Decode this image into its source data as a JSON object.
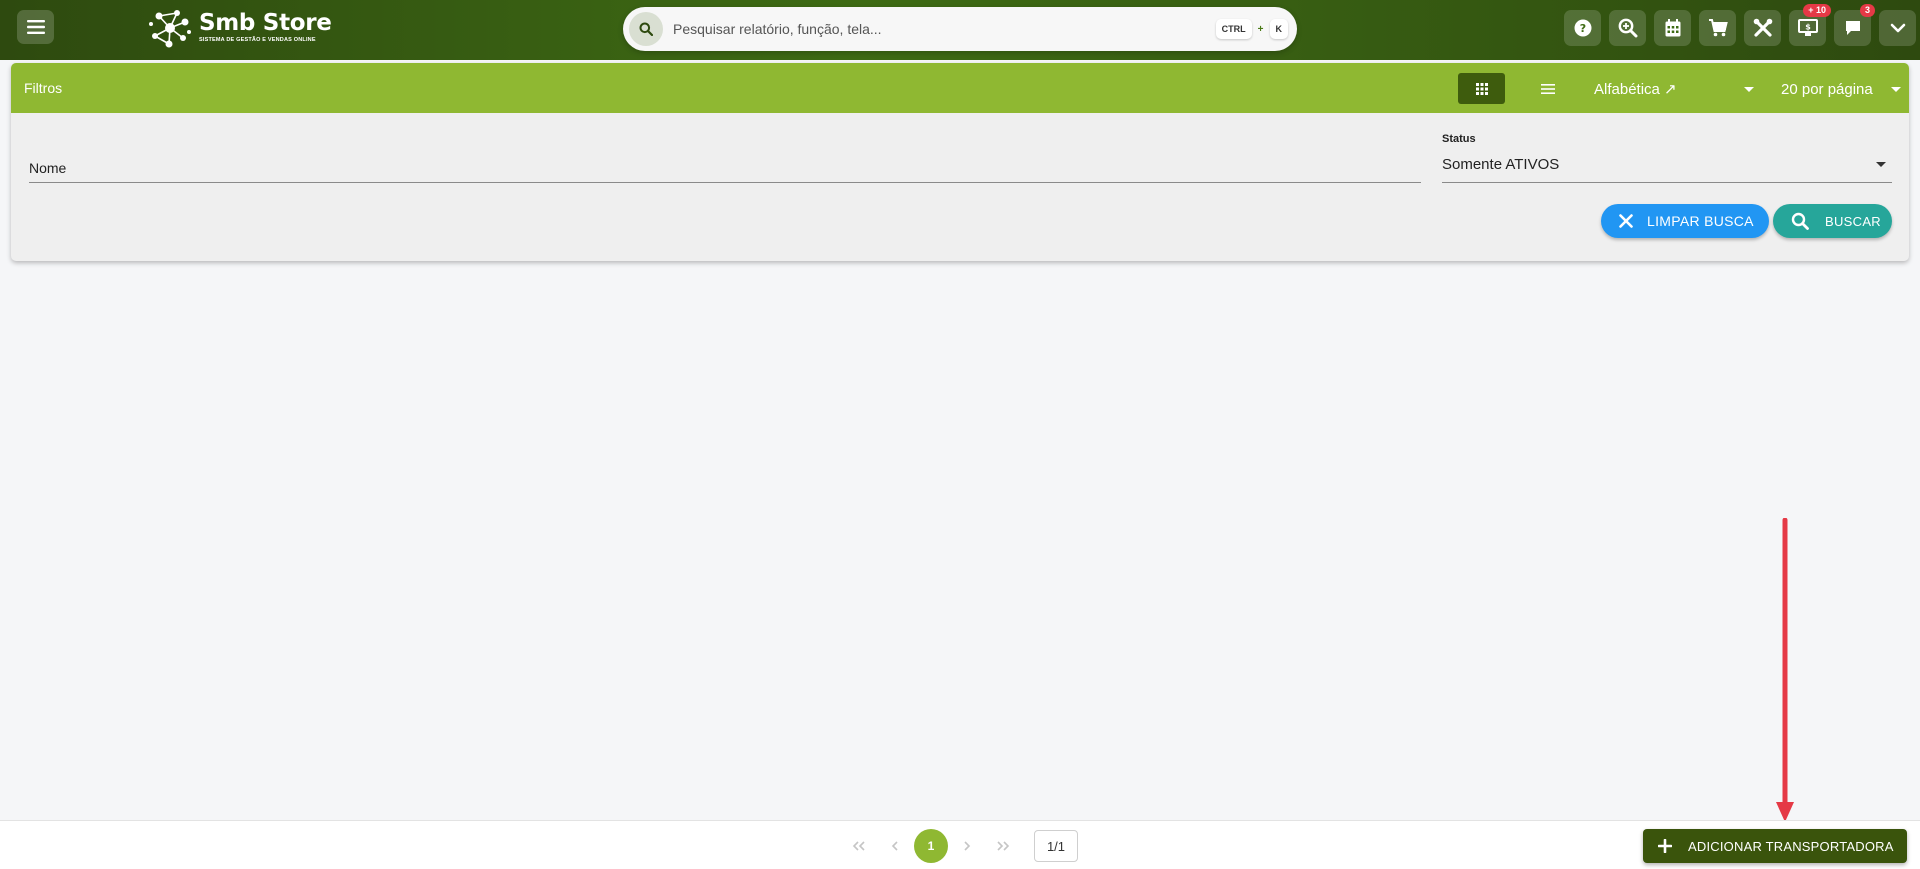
{
  "header": {
    "brand_name": "Smb Store",
    "brand_tagline": "SISTEMA DE GESTÃO E VENDAS ONLINE",
    "search": {
      "placeholder": "Pesquisar relatório, função, tela...",
      "shortcut_modifier": "CTRL",
      "shortcut_plus": "+",
      "shortcut_key": "K"
    },
    "icons": [
      {
        "name": "help-icon"
      },
      {
        "name": "zoom-search-icon"
      },
      {
        "name": "calendar-icon"
      },
      {
        "name": "cart-icon"
      },
      {
        "name": "tools-icon"
      },
      {
        "name": "monitor-icon",
        "badge": "+ 10"
      },
      {
        "name": "chat-icon",
        "badge": "3"
      },
      {
        "name": "chevron-down-icon"
      }
    ]
  },
  "filters": {
    "title": "Filtros",
    "sort_value": "Alfabética ↗",
    "per_page_value": "20 por página",
    "name_field_label": "Nome",
    "status_label": "Status",
    "status_value": "Somente ATIVOS",
    "clear_button": "LIMPAR BUSCA",
    "search_button": "BUSCAR"
  },
  "pagination": {
    "current_page": "1",
    "total": "1/1"
  },
  "footer": {
    "add_button": "ADICIONAR TRANSPORTADORA"
  },
  "colors": {
    "header_dark": "#2e4a0f",
    "filter_header": "#8fb832",
    "clear_button": "#2196f3",
    "search_button": "#26a69a",
    "add_button": "#3a540c",
    "badge": "#e53946",
    "annotation_arrow": "#e53946"
  }
}
